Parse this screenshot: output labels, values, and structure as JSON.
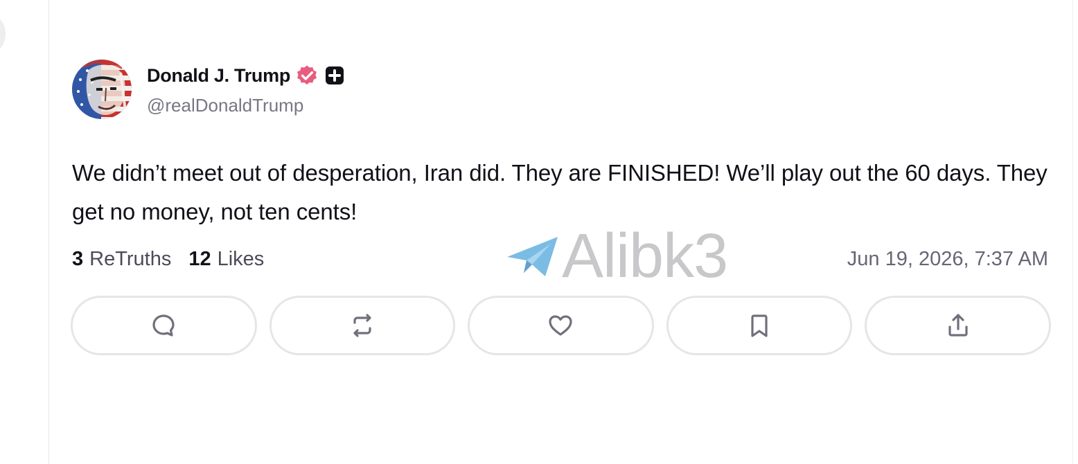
{
  "colors": {
    "verified_badge": "#e85d7f",
    "plus_badge": "#111118",
    "text_primary": "#101018",
    "text_secondary": "#777785",
    "button_border": "#e5e5ea",
    "watermark_blue": "#4ea5dc"
  },
  "author": {
    "display_name": "Donald J. Trump",
    "handle": "@realDonaldTrump",
    "verified_icon": "verified-badge-icon",
    "plus_icon": "plus-badge-icon"
  },
  "post": {
    "text": "We didn’t meet out of desperation, Iran did. They are FINISHED! We’ll play out the 60 days. They get no money, not ten cents!",
    "stats": {
      "retruths_count": "3",
      "retruths_label": "ReTruths",
      "likes_count": "12",
      "likes_label": "Likes"
    },
    "timestamp": "Jun 19, 2026, 7:37 AM"
  },
  "actions": [
    {
      "name": "reply",
      "icon": "comment-icon"
    },
    {
      "name": "retruth",
      "icon": "repost-icon"
    },
    {
      "name": "like",
      "icon": "heart-icon"
    },
    {
      "name": "bookmark",
      "icon": "bookmark-icon"
    },
    {
      "name": "share",
      "icon": "share-icon"
    }
  ],
  "watermark": {
    "text": "Alibk3",
    "icon": "telegram-plane-icon"
  }
}
